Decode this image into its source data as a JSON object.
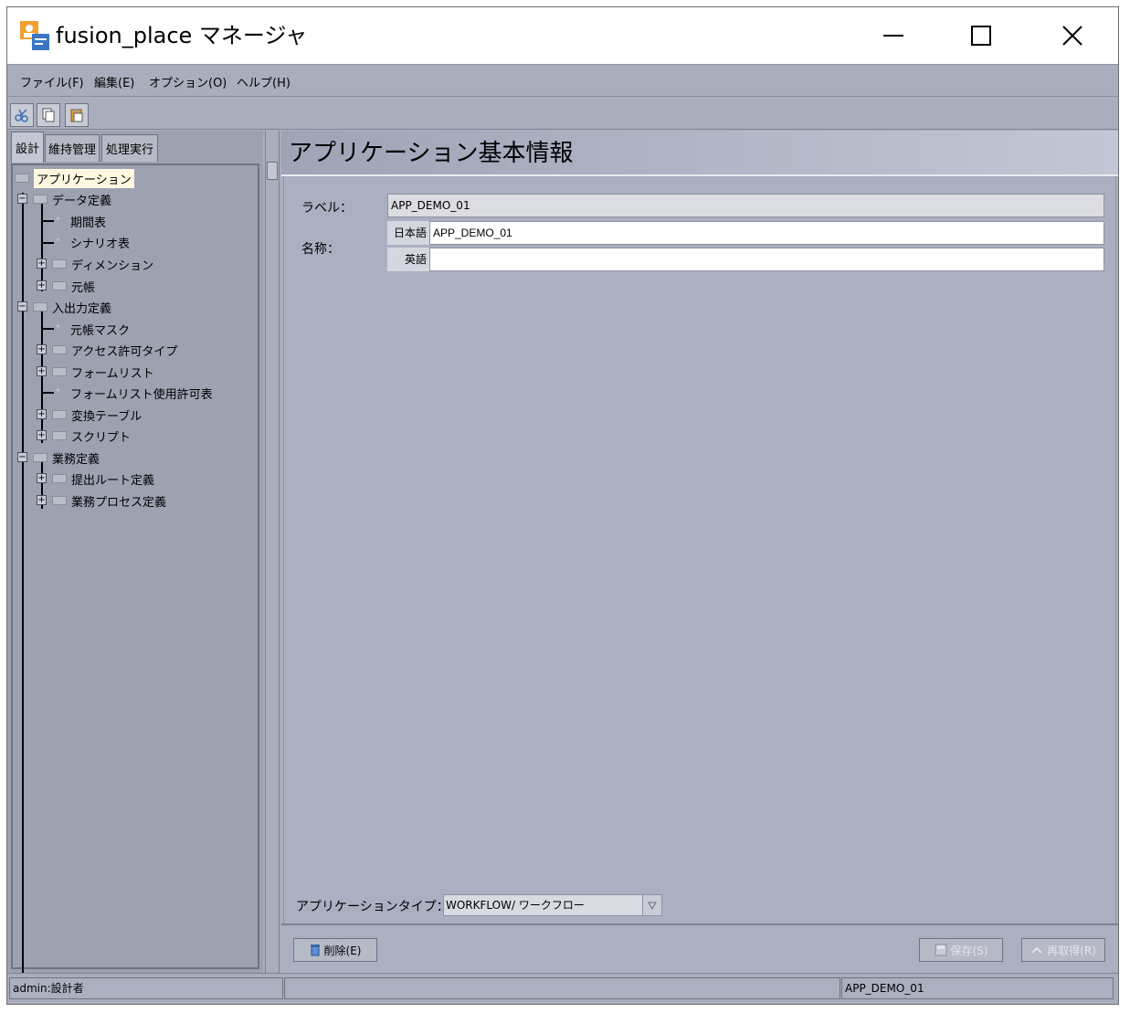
{
  "window": {
    "title": "fusion_place マネージャ"
  },
  "menu": {
    "items": [
      {
        "label": "ファイル(F)"
      },
      {
        "label": "編集(E)"
      },
      {
        "label": "オプション(O)"
      },
      {
        "label": "ヘルプ(H)"
      }
    ]
  },
  "toolbar": {
    "icons": [
      "cut-icon",
      "copy-icon",
      "paste-icon"
    ]
  },
  "left": {
    "tabs": [
      {
        "label": "設計",
        "active": true
      },
      {
        "label": "維持管理",
        "active": false
      },
      {
        "label": "処理実行",
        "active": false
      }
    ],
    "tree": [
      {
        "label": "アプリケーション",
        "selected": true
      },
      {
        "label": "データ定義"
      },
      {
        "label": "期間表"
      },
      {
        "label": "シナリオ表"
      },
      {
        "label": "ディメンション"
      },
      {
        "label": "元帳"
      },
      {
        "label": "入出力定義"
      },
      {
        "label": "元帳マスク"
      },
      {
        "label": "アクセス許可タイプ"
      },
      {
        "label": "フォームリスト"
      },
      {
        "label": "フォームリスト使用許可表"
      },
      {
        "label": "変換テーブル"
      },
      {
        "label": "スクリプト"
      },
      {
        "label": "業務定義"
      },
      {
        "label": "提出ルート定義"
      },
      {
        "label": "業務プロセス定義"
      }
    ]
  },
  "main": {
    "header_title": "アプリケーション基本情報",
    "label_caption": "ラベル：",
    "label_value": "APP_DEMO_01",
    "name_caption": "名称：",
    "name_ja_caption": "日本語",
    "name_ja_value": "APP_DEMO_01",
    "name_en_caption": "英語",
    "name_en_value": "",
    "app_type_caption": "アプリケーションタイプ：",
    "app_type_value": "WORKFLOW/ ワークフロー",
    "delete_label": "削除(E)",
    "save_label": "保存(S)",
    "cancel_label": "再取得(R)"
  },
  "status": {
    "user": "admin:設計者",
    "middle": "",
    "app": "APP_DEMO_01"
  },
  "colors": {
    "pane_bg": "#aab0c0",
    "tree_bg": "#9da2b1",
    "header_gradient_end": "#c2c7d5",
    "selected_node_bg": "#fff8e0"
  }
}
